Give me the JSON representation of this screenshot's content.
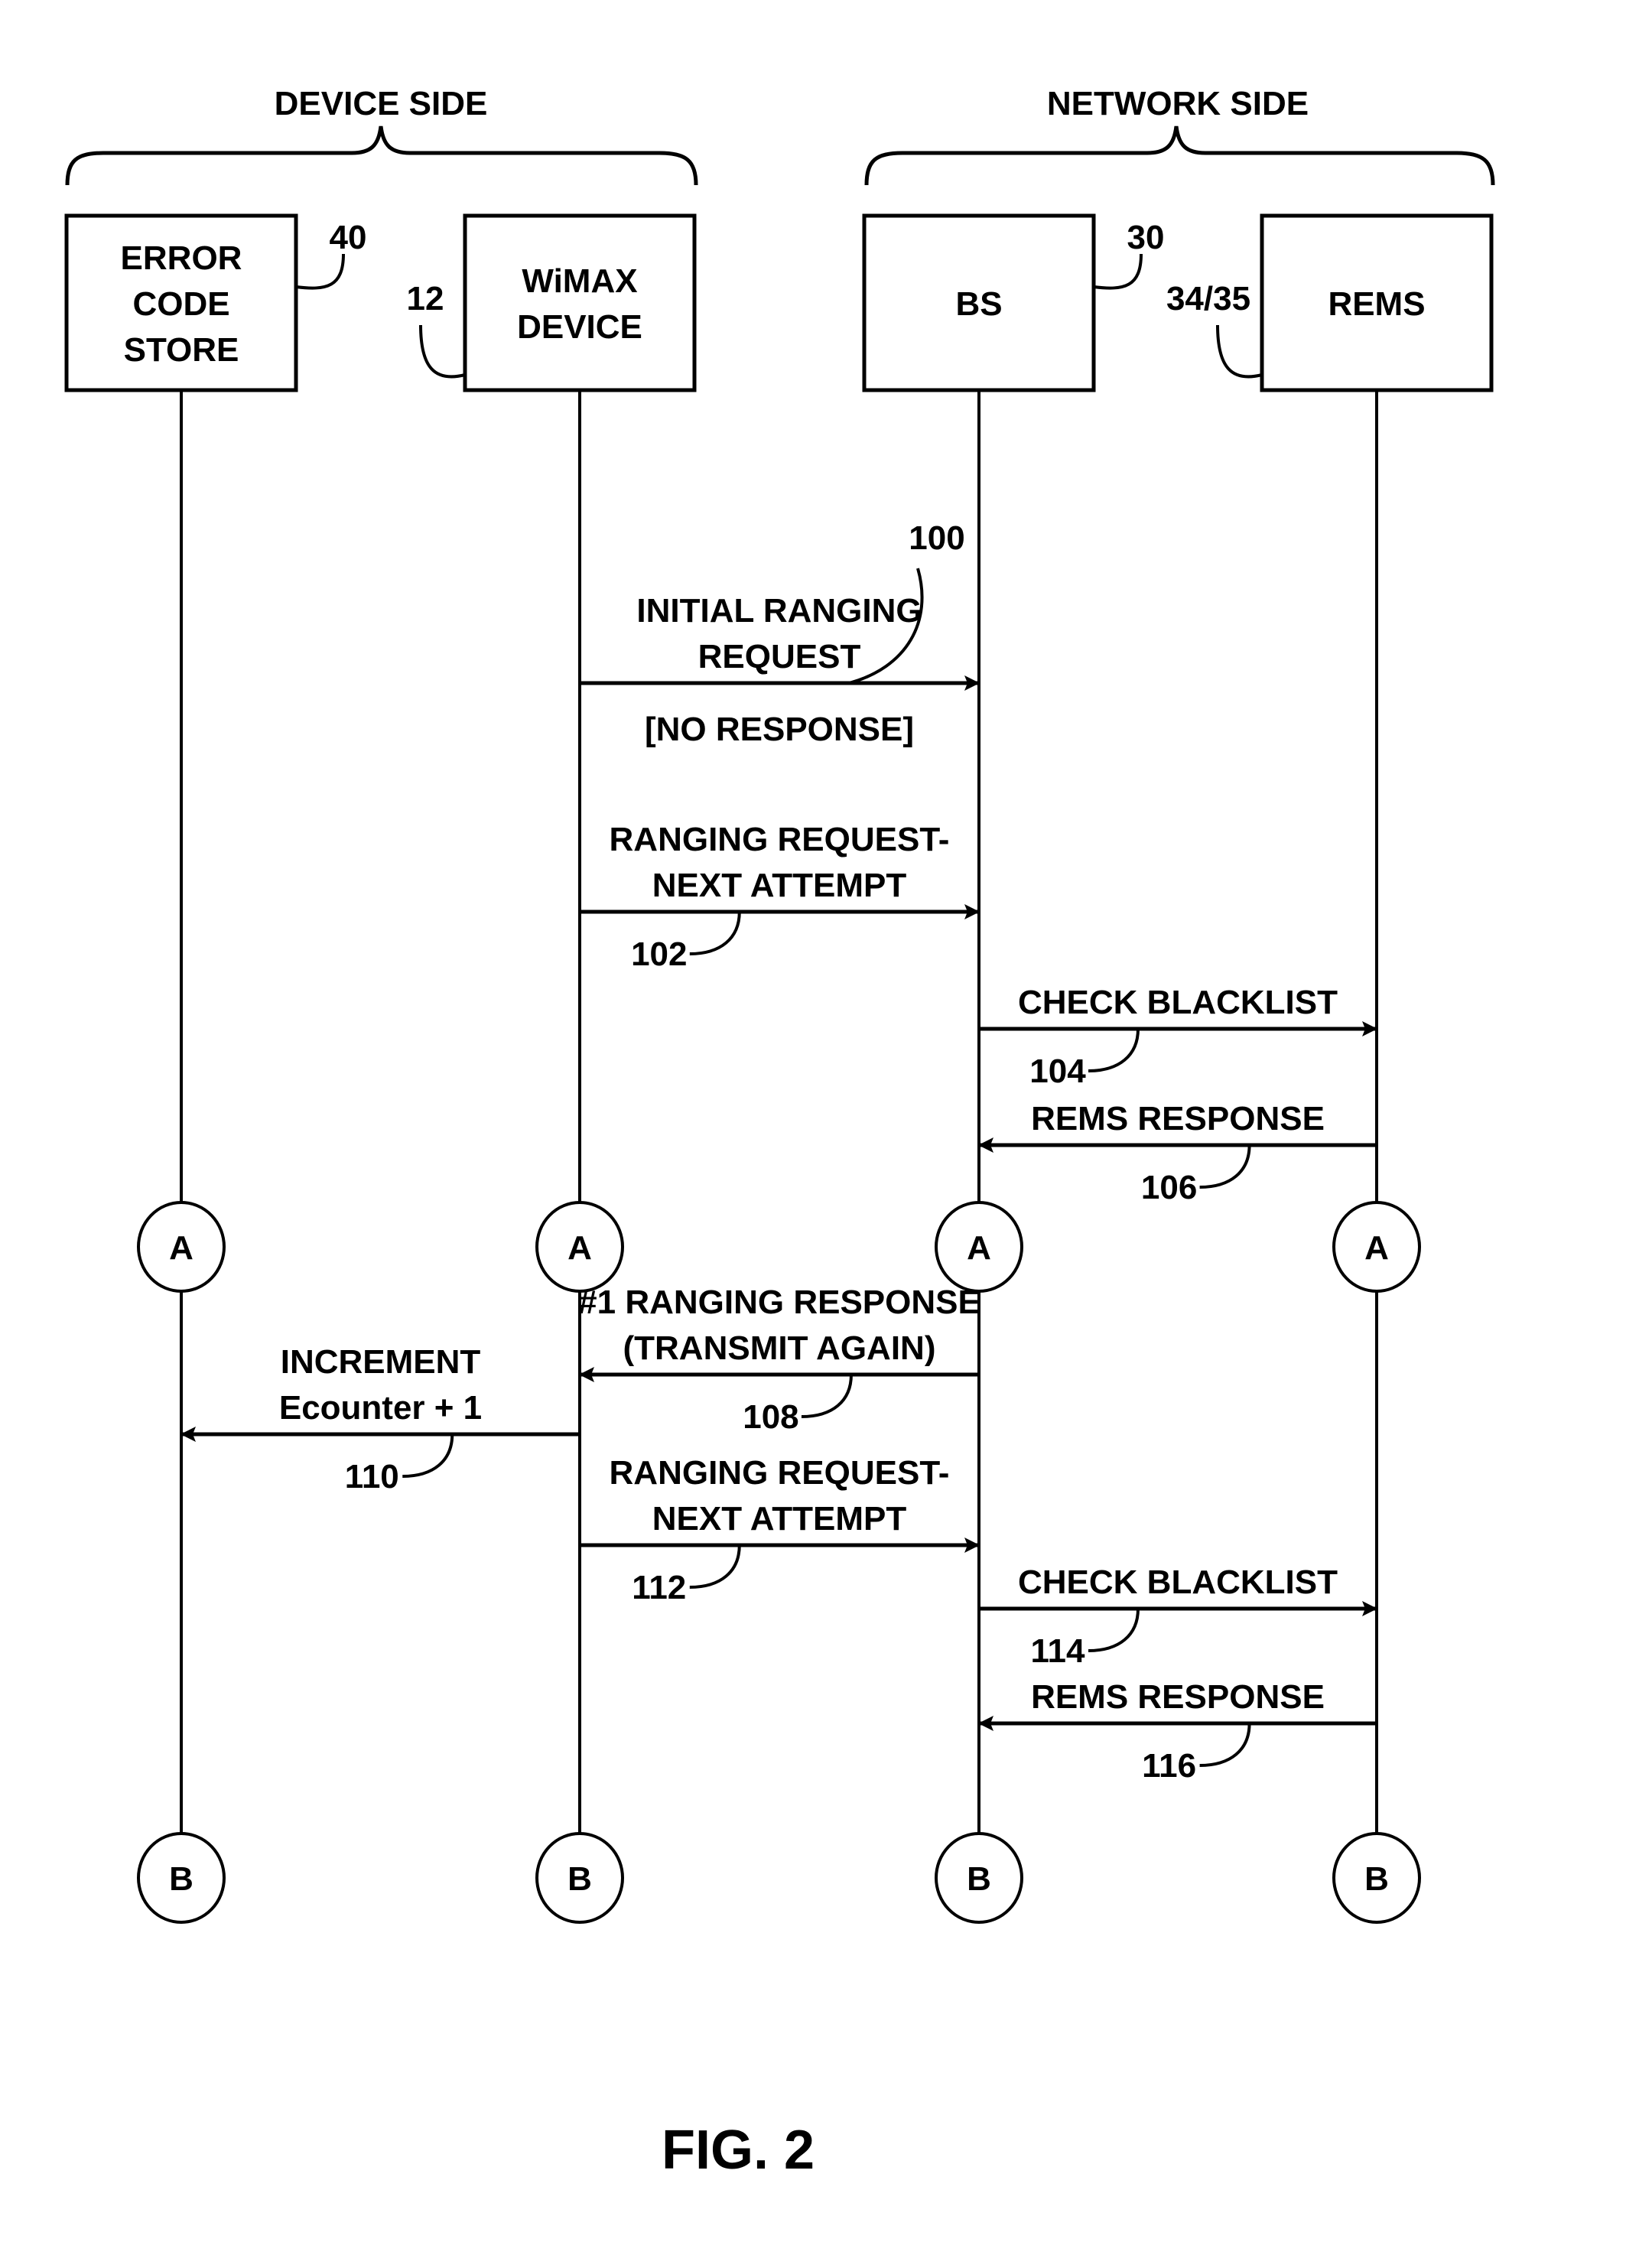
{
  "figure": {
    "caption": "FIG. 2"
  },
  "groups": [
    {
      "id": "device-side",
      "label": "DEVICE SIDE",
      "participants": [
        "error-code-store",
        "wimax-device"
      ]
    },
    {
      "id": "network-side",
      "label": "NETWORK SIDE",
      "participants": [
        "bs",
        "rems"
      ]
    }
  ],
  "participants": [
    {
      "id": "error-code-store",
      "lines": [
        "ERROR",
        "CODE",
        "STORE"
      ],
      "ref": "40",
      "ref_side": "right"
    },
    {
      "id": "wimax-device",
      "lines": [
        "WiMAX",
        "DEVICE"
      ],
      "ref": "12",
      "ref_side": "left"
    },
    {
      "id": "bs",
      "lines": [
        "BS"
      ],
      "ref": "30",
      "ref_side": "right"
    },
    {
      "id": "rems",
      "lines": [
        "REMS"
      ],
      "ref": "34/35",
      "ref_side": "left"
    }
  ],
  "connectors": [
    {
      "label": "A",
      "section": "1"
    },
    {
      "label": "B",
      "section": "2"
    }
  ],
  "messages": [
    {
      "ref": "100",
      "from": 1,
      "to": 2,
      "lines": [
        "INITIAL RANGING",
        "REQUEST"
      ],
      "note": "[NO RESPONSE]",
      "section": 1
    },
    {
      "ref": "102",
      "from": 1,
      "to": 2,
      "lines": [
        "RANGING REQUEST-",
        "NEXT ATTEMPT"
      ],
      "section": 1
    },
    {
      "ref": "104",
      "from": 2,
      "to": 3,
      "lines": [
        "CHECK BLACKLIST"
      ],
      "section": 1
    },
    {
      "ref": "106",
      "from": 3,
      "to": 2,
      "lines": [
        "REMS RESPONSE"
      ],
      "section": 1
    },
    {
      "ref": "108",
      "from": 2,
      "to": 1,
      "lines": [
        "#1 RANGING RESPONSE",
        "(TRANSMIT AGAIN)"
      ],
      "section": 2
    },
    {
      "ref": "110",
      "from": 1,
      "to": 0,
      "lines": [
        "INCREMENT",
        "Ecounter + 1"
      ],
      "section": 2
    },
    {
      "ref": "112",
      "from": 1,
      "to": 2,
      "lines": [
        "RANGING REQUEST-",
        "NEXT ATTEMPT"
      ],
      "section": 2
    },
    {
      "ref": "114",
      "from": 2,
      "to": 3,
      "lines": [
        "CHECK BLACKLIST"
      ],
      "section": 2
    },
    {
      "ref": "116",
      "from": 3,
      "to": 2,
      "lines": [
        "REMS RESPONSE"
      ],
      "section": 2
    }
  ]
}
